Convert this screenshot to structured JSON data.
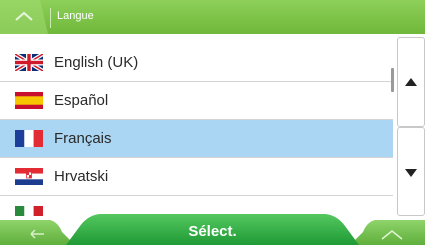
{
  "header": {
    "title": "Langue"
  },
  "languages": [
    {
      "label": "English (UK)"
    },
    {
      "label": "Español"
    },
    {
      "label": "Français",
      "selected": true
    },
    {
      "label": "Hrvatski"
    }
  ],
  "footer": {
    "select_label": "Sélect."
  },
  "colors": {
    "header_green": "#7cc44a",
    "selected_row": "#aad5f3",
    "button_green": "#3bb34a"
  }
}
